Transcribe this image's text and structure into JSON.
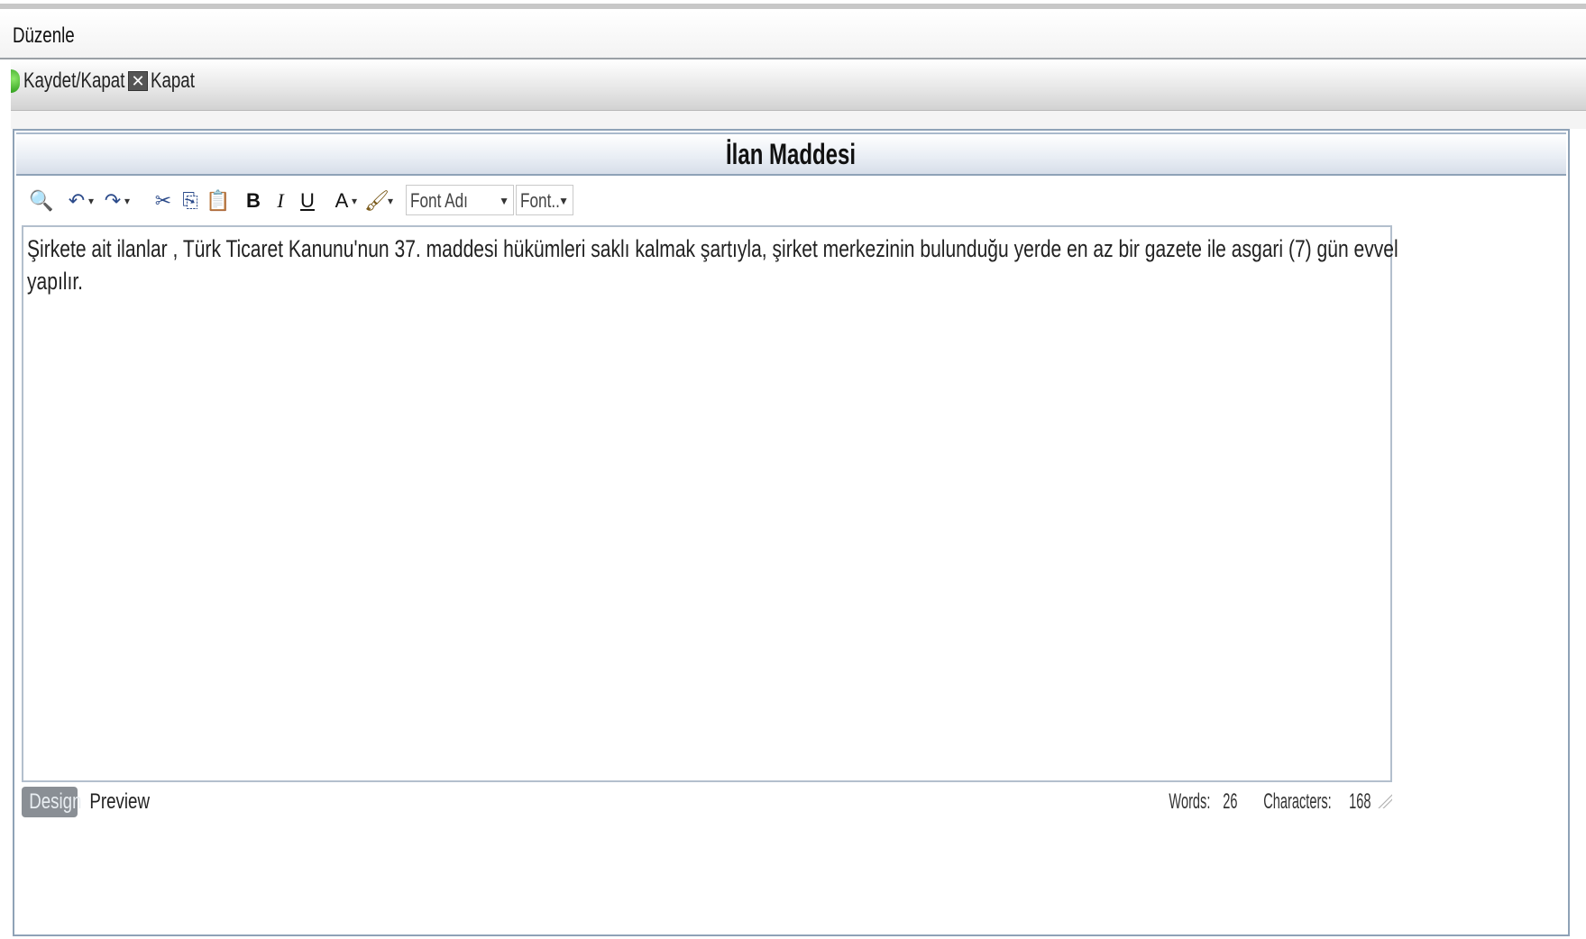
{
  "menubar": {
    "title": "Düzenle"
  },
  "toolbar": {
    "save_close_label": "Kaydet/Kapat",
    "close_label": "Kapat"
  },
  "panel": {
    "title": "İlan Maddesi"
  },
  "editor": {
    "toolbar": {
      "icons": [
        "find-icon",
        "undo-icon",
        "redo-icon",
        "cut-icon",
        "copy-icon",
        "paste-icon",
        "bold-icon",
        "italic-icon",
        "underline-icon",
        "font-color-icon",
        "highlight-icon"
      ],
      "font_name": "Font Adı",
      "font_size": "Font.."
    },
    "content": "Şirkete ait ilanlar , Türk Ticaret Kanunu'nun 37. maddesi hükümleri saklı kalmak şartıyla, şirket merkezinin bulunduğu yerde en az bir gazete ile asgari (7) gün evvel yapılır."
  },
  "status": {
    "design_tab": "Design",
    "preview_tab": "Preview",
    "words_label": "Words:",
    "words": "26",
    "chars_label": "Characters:",
    "chars": "168"
  }
}
